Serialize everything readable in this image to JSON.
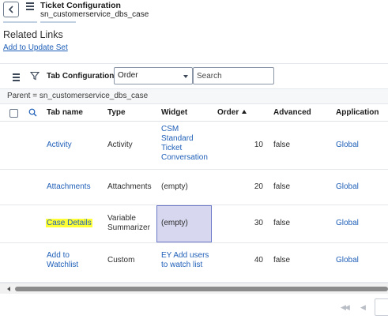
{
  "header": {
    "title": "Ticket Configuration",
    "subtitle": "sn_customerservice_dbs_case"
  },
  "related_links": {
    "title": "Related Links",
    "link": "Add to Update Set"
  },
  "list": {
    "title": "Tab Configurations",
    "field_select_value": "Order",
    "search_placeholder": "Search",
    "breadcrumb": "Parent = sn_customerservice_dbs_case"
  },
  "table": {
    "columns": [
      "Tab name",
      "Type",
      "Widget",
      "Order",
      "Advanced",
      "Application"
    ],
    "sort_column": "Order",
    "sort_direction": "ascending",
    "rows": [
      {
        "tab_name": "Activity",
        "type": "Activity",
        "widget_lines": [
          "CSM",
          "Standard",
          "Ticket",
          "Conversation"
        ],
        "widget_is_link": true,
        "order": "10",
        "advanced": "false",
        "application": "Global"
      },
      {
        "tab_name": "Attachments",
        "type": "Attachments",
        "widget_lines": [
          "(empty)"
        ],
        "widget_is_link": false,
        "order": "20",
        "advanced": "false",
        "application": "Global"
      },
      {
        "tab_name": "Case Details",
        "type": "Variable Summarizer",
        "type_lines": [
          "Variable",
          "Summarizer"
        ],
        "widget_lines": [
          "(empty)"
        ],
        "widget_is_link": false,
        "order": "30",
        "advanced": "false",
        "application": "Global",
        "tab_name_highlighted": true,
        "widget_selected": true
      },
      {
        "tab_name": "Add to Watchlist",
        "tab_name_lines": [
          "Add to",
          "Watchlist"
        ],
        "type": "Custom",
        "widget_lines": [
          "EY Add users",
          "to watch list"
        ],
        "widget_is_link": true,
        "order": "40",
        "advanced": "false",
        "application": "Global"
      }
    ]
  },
  "icons": {
    "back": "chevron-left-icon",
    "menu": "hamburger-menu-icon",
    "filter": "funnel-filter-icon",
    "column_search": "magnifier-icon",
    "pager_first": "double-chevron-left-icon",
    "pager_prev": "chevron-left-icon"
  },
  "colors": {
    "link": "#1f5fb8",
    "highlight": "#ffff33",
    "selected_cell": "#d7d8ef"
  }
}
